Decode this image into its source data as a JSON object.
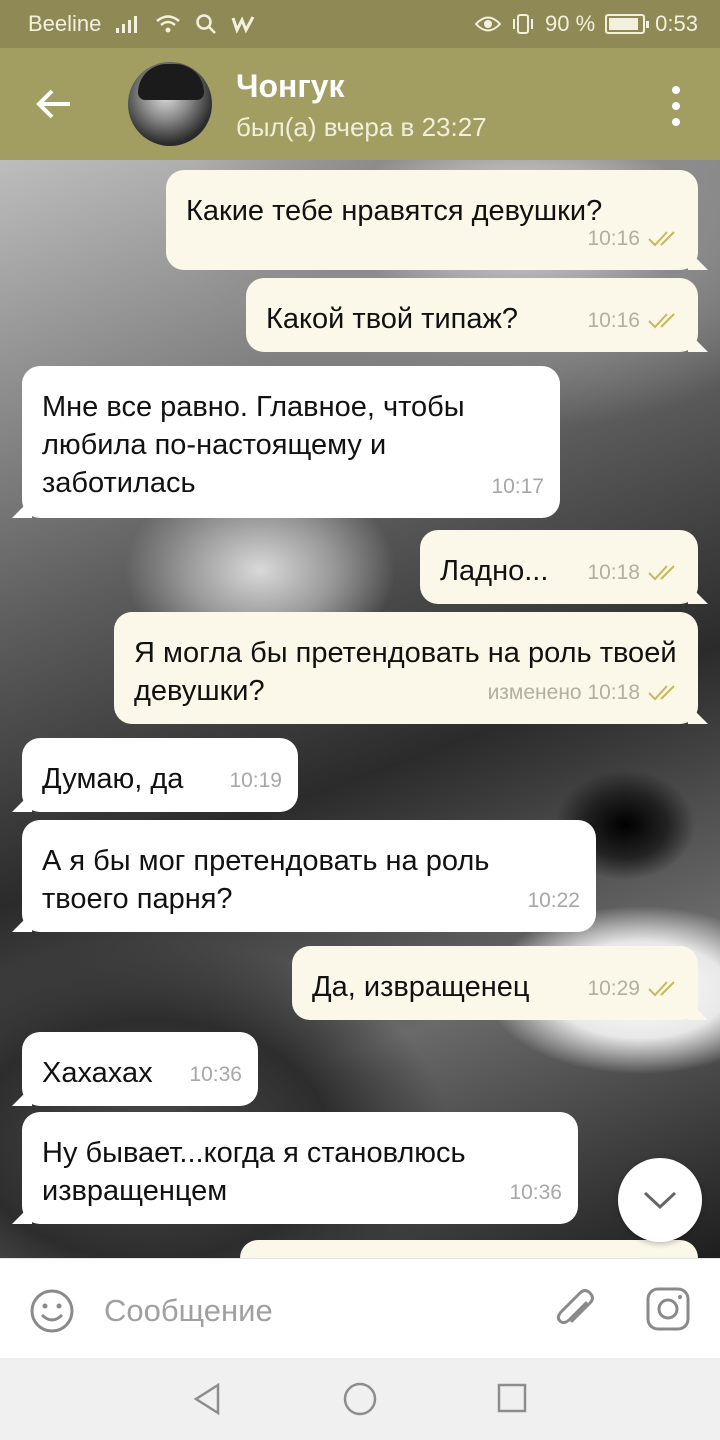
{
  "status_bar": {
    "carrier": "Beeline",
    "battery_percent": "90 %",
    "battery_level": 0.9,
    "time": "0:53",
    "icons": [
      "signal-icon",
      "wifi-icon",
      "search-icon",
      "app-icon",
      "eye-icon",
      "vibrate-icon",
      "battery-icon"
    ]
  },
  "header": {
    "contact_name": "Чонгук",
    "last_seen": "был(а) вчера в 23:27"
  },
  "messages": [
    {
      "side": "out",
      "text": "Какие тебе нравятся девушки?",
      "time": "10:16",
      "read": true
    },
    {
      "side": "out",
      "text": "Какой твой типаж?",
      "time": "10:16",
      "read": true
    },
    {
      "side": "in",
      "text": "Мне все равно. Главное, чтобы любила по-настоящему и заботилась",
      "time": "10:17"
    },
    {
      "side": "out",
      "text": "Ладно...",
      "time": "10:18",
      "read": true
    },
    {
      "side": "out",
      "text": "Я могла бы претендовать на роль твоей девушки?",
      "time": "изменено 10:18",
      "read": true
    },
    {
      "side": "in",
      "text": "Думаю, да",
      "time": "10:19"
    },
    {
      "side": "in",
      "text": "А я бы мог претендовать на роль твоего парня?",
      "time": "10:22"
    },
    {
      "side": "out",
      "text": "Да, извращенец",
      "time": "10:29",
      "read": true
    },
    {
      "side": "in",
      "text": "Хахахах",
      "time": "10:36"
    },
    {
      "side": "in",
      "text": "Ну бывает...когда я становлюсь извращенцем",
      "time": "10:36"
    }
  ],
  "input": {
    "placeholder": "Сообщение"
  },
  "colors": {
    "header": "#a29e62",
    "status_bar": "#8f8a55",
    "outgoing_bubble": "#fbf8ea",
    "incoming_bubble": "#ffffff",
    "read_ticks": "#c9b85a"
  }
}
